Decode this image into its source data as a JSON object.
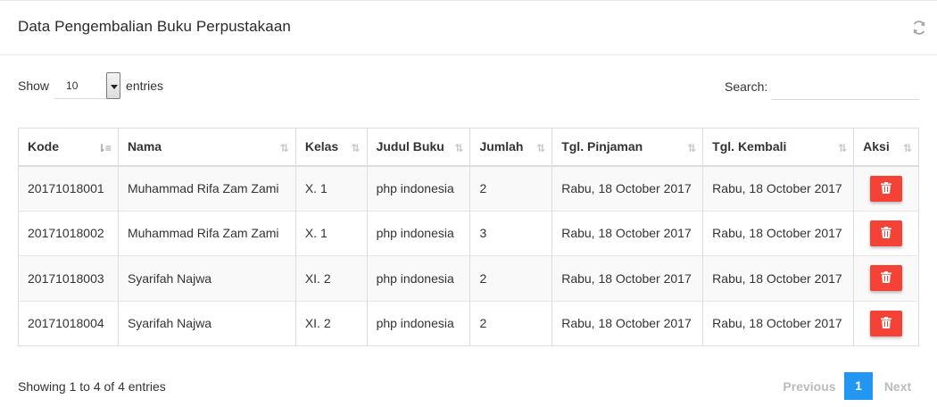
{
  "card": {
    "title": "Data Pengembalian Buku Perpustakaan",
    "refresh_icon": "refresh-icon"
  },
  "length": {
    "show_label": "Show",
    "selected": "10",
    "entries_label": "entries"
  },
  "search": {
    "label": "Search:",
    "value": "",
    "placeholder": ""
  },
  "table": {
    "headers": [
      "Kode",
      "Nama",
      "Kelas",
      "Judul Buku",
      "Jumlah",
      "Tgl. Pinjaman",
      "Tgl. Kembali",
      "Aksi"
    ],
    "sorted_column": "Kode",
    "rows": [
      [
        "20171018001",
        "Muhammad Rifa Zam Zami",
        "X. 1",
        "php indonesia",
        "2",
        "Rabu, 18 October 2017",
        "Rabu, 18 October 2017"
      ],
      [
        "20171018002",
        "Muhammad Rifa Zam Zami",
        "X. 1",
        "php indonesia",
        "3",
        "Rabu, 18 October 2017",
        "Rabu, 18 October 2017"
      ],
      [
        "20171018003",
        "Syarifah Najwa",
        "XI. 2",
        "php indonesia",
        "2",
        "Rabu, 18 October 2017",
        "Rabu, 18 October 2017"
      ],
      [
        "20171018004",
        "Syarifah Najwa",
        "XI. 2",
        "php indonesia",
        "2",
        "Rabu, 18 October 2017",
        "Rabu, 18 October 2017"
      ]
    ],
    "action_icon": "trash-icon"
  },
  "info": "Showing 1 to 4 of 4 entries",
  "pagination": {
    "previous": "Previous",
    "current_page": "1",
    "next": "Next"
  },
  "colors": {
    "delete_button": "#f44336",
    "active_page": "#2196f3",
    "disabled_page": "#bbbbbb",
    "stripe": "#f9f9f9"
  }
}
